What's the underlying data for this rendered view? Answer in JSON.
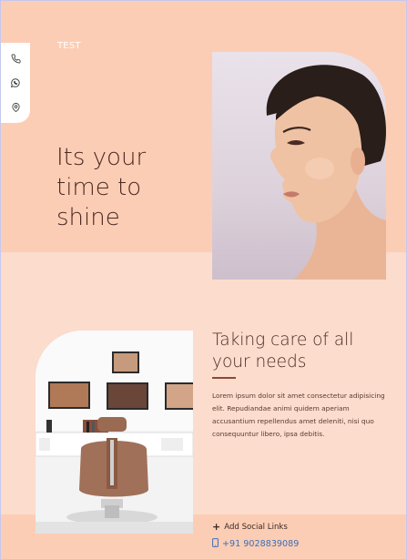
{
  "brand": {
    "name": "TEST"
  },
  "sidebar": {
    "icons": [
      {
        "name": "phone-icon"
      },
      {
        "name": "whatsapp-icon"
      },
      {
        "name": "location-pin-icon"
      }
    ]
  },
  "hero": {
    "title_line1": "Its your",
    "title_line2": "time to",
    "title_line3": "shine"
  },
  "about": {
    "title_line1": "Taking care of all",
    "title_line2": "your needs",
    "body": "Lorem ipsum dolor sit amet consectetur adipisicing elit. Repudiandae animi quidem aperiam accusantium repellendus amet deleniti, nisi quo consequuntur libero, ipsa debitis."
  },
  "contact": {
    "social_label": "Add Social Links",
    "phone": "+91 9028839089"
  },
  "colors": {
    "hero_bg": "#fccdb5",
    "section_bg": "#fbdccd",
    "accent": "#8a4a38",
    "link": "#3a6fb8"
  }
}
